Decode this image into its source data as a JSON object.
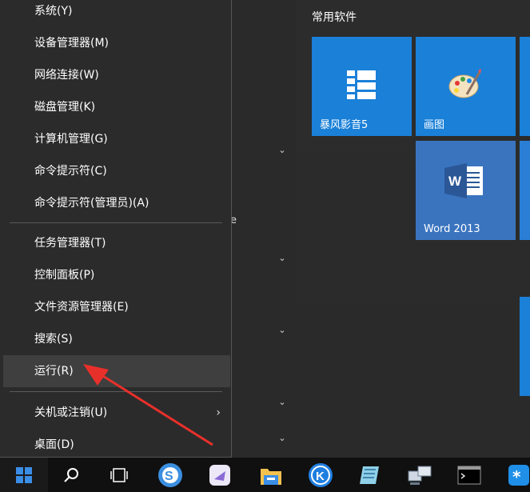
{
  "winx_menu": {
    "items": [
      {
        "label": "系统(Y)"
      },
      {
        "label": "设备管理器(M)"
      },
      {
        "label": "网络连接(W)"
      },
      {
        "label": "磁盘管理(K)"
      },
      {
        "label": "计算机管理(G)"
      },
      {
        "label": "命令提示符(C)"
      },
      {
        "label": "命令提示符(管理员)(A)"
      },
      {
        "label": "任务管理器(T)"
      },
      {
        "label": "控制面板(P)"
      },
      {
        "label": "文件资源管理器(E)"
      },
      {
        "label": "搜索(S)"
      },
      {
        "label": "运行(R)"
      },
      {
        "label": "关机或注销(U)"
      },
      {
        "label": "桌面(D)"
      }
    ],
    "highlighted": "运行(R)",
    "submenu_glyph": "›"
  },
  "start": {
    "group_title": "常用软件",
    "stray_char": "e",
    "tiles": [
      {
        "label": "暴风影音5",
        "icon": "baofeng-icon",
        "color": "#1a80d8"
      },
      {
        "label": "画图",
        "icon": "paint-palette-icon",
        "color": "#1a80d8"
      },
      {
        "label": "Word 2013",
        "icon": "word-icon",
        "color": "#3a74bf"
      }
    ],
    "chevron": "⌄"
  },
  "annotation": {
    "arrow_color": "#e8302a"
  },
  "taskbar": {
    "icons": [
      "windows-start-icon",
      "search-icon",
      "task-view-icon",
      "sogou-icon",
      "app-icon",
      "file-explorer-icon",
      "kugou-icon",
      "notepad-icon",
      "network-icon",
      "cmd-icon",
      "app-star-icon"
    ]
  }
}
